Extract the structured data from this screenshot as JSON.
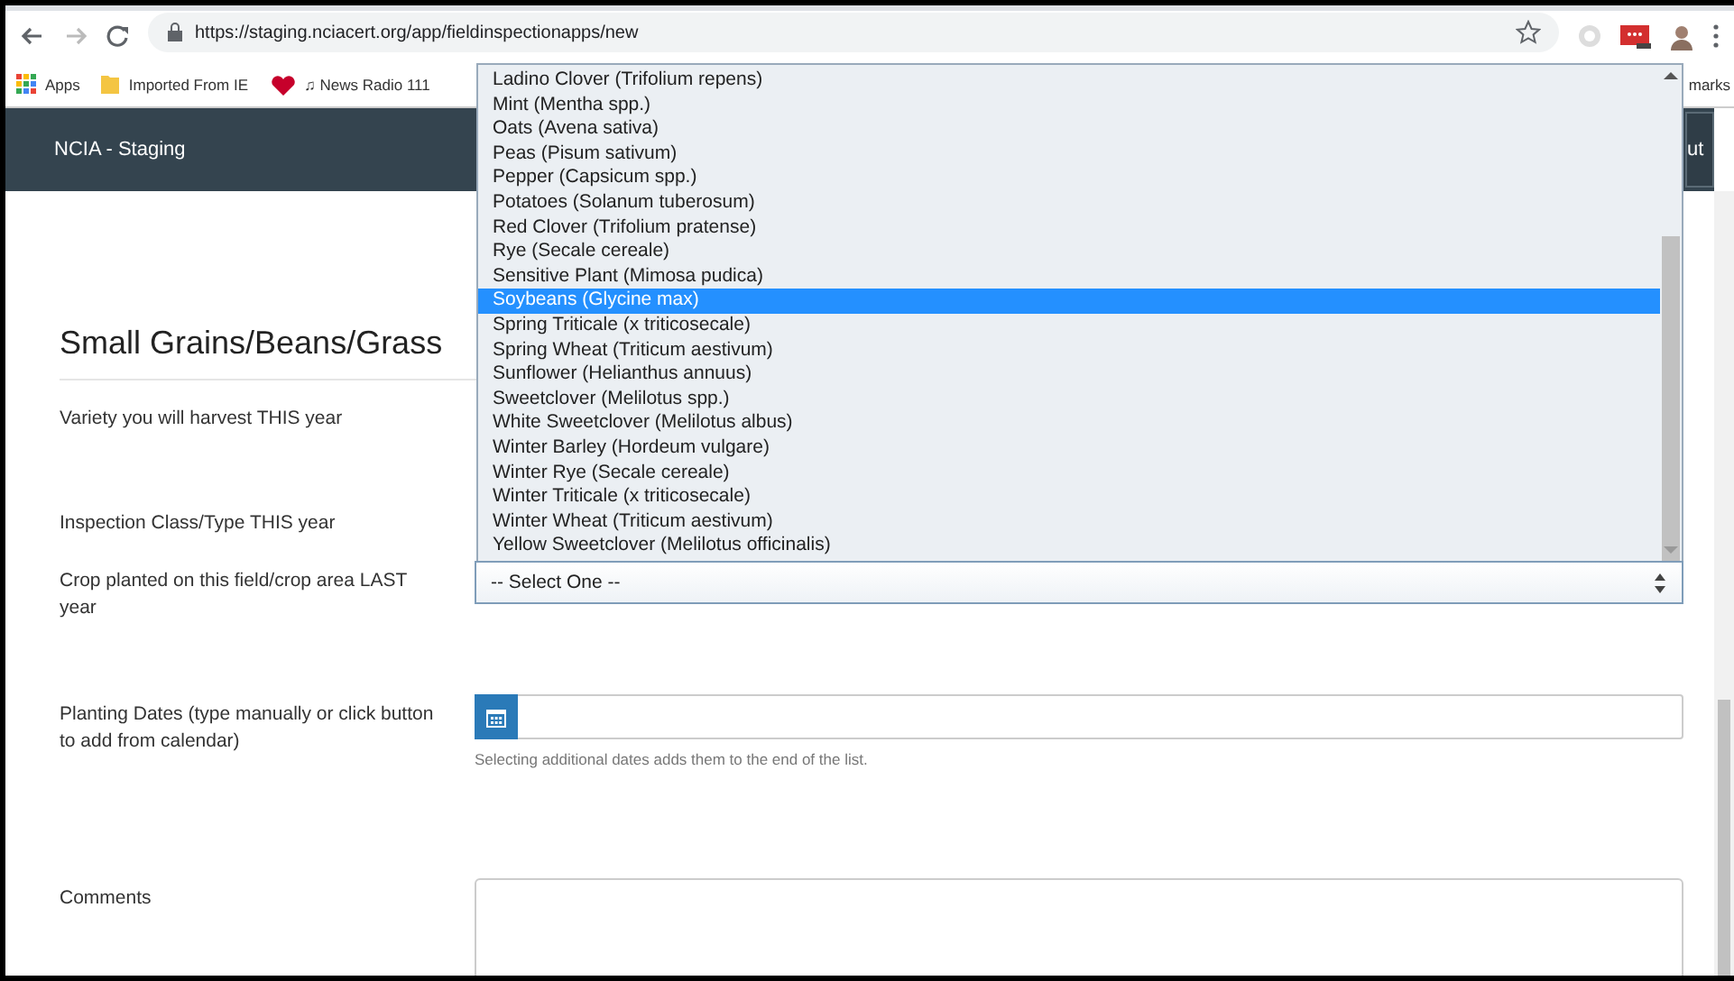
{
  "browser": {
    "url": "https://staging.nciacert.org/app/fieldinspectionapps/new",
    "bookmarks": [
      {
        "label": "Apps",
        "kind": "apps"
      },
      {
        "label": "Imported From IE",
        "kind": "folder"
      },
      {
        "label": "♫ News Radio 111",
        "kind": "radio"
      }
    ],
    "bookmarks_end": "marks"
  },
  "navbar": {
    "brand": "NCIA - Staging",
    "right_button": "ut"
  },
  "page": {
    "heading": "Small Grains/Beans/Grass",
    "fields": [
      {
        "label": "Variety you will harvest THIS year",
        "kind": "blank"
      },
      {
        "label": "Inspection Class/Type THIS year",
        "kind": "blank"
      },
      {
        "label": "Crop planted on this field/crop area LAST year",
        "kind": "select",
        "value": "-- Select One --",
        "expanded": true,
        "options": [
          {
            "label": "Ladino Clover (Trifolium repens)",
            "selected": false
          },
          {
            "label": "Mint (Mentha spp.)",
            "selected": false
          },
          {
            "label": "Oats (Avena sativa)",
            "selected": false
          },
          {
            "label": "Peas (Pisum sativum)",
            "selected": false
          },
          {
            "label": "Pepper (Capsicum spp.)",
            "selected": false
          },
          {
            "label": "Potatoes (Solanum tuberosum)",
            "selected": false
          },
          {
            "label": "Red Clover (Trifolium pratense)",
            "selected": false
          },
          {
            "label": "Rye (Secale cereale)",
            "selected": false
          },
          {
            "label": "Sensitive Plant (Mimosa pudica)",
            "selected": false
          },
          {
            "label": "Soybeans (Glycine max)",
            "selected": true
          },
          {
            "label": "Spring Triticale (x triticosecale)",
            "selected": false
          },
          {
            "label": "Spring Wheat (Triticum aestivum)",
            "selected": false
          },
          {
            "label": "Sunflower (Helianthus annuus)",
            "selected": false
          },
          {
            "label": "Sweetclover (Melilotus spp.)",
            "selected": false
          },
          {
            "label": "White Sweetclover (Melilotus albus)",
            "selected": false
          },
          {
            "label": "Winter Barley (Hordeum vulgare)",
            "selected": false
          },
          {
            "label": "Winter Rye (Secale cereale)",
            "selected": false
          },
          {
            "label": "Winter Triticale (x triticosecale)",
            "selected": false
          },
          {
            "label": "Winter Wheat (Triticum aestivum)",
            "selected": false
          },
          {
            "label": "Yellow Sweetclover (Melilotus officinalis)",
            "selected": false
          }
        ]
      },
      {
        "label": "Planting Dates (type manually or click button to add from calendar)",
        "kind": "date",
        "help": "Selecting additional dates adds them to the end of the list."
      },
      {
        "label": "Comments",
        "kind": "textarea"
      }
    ]
  }
}
